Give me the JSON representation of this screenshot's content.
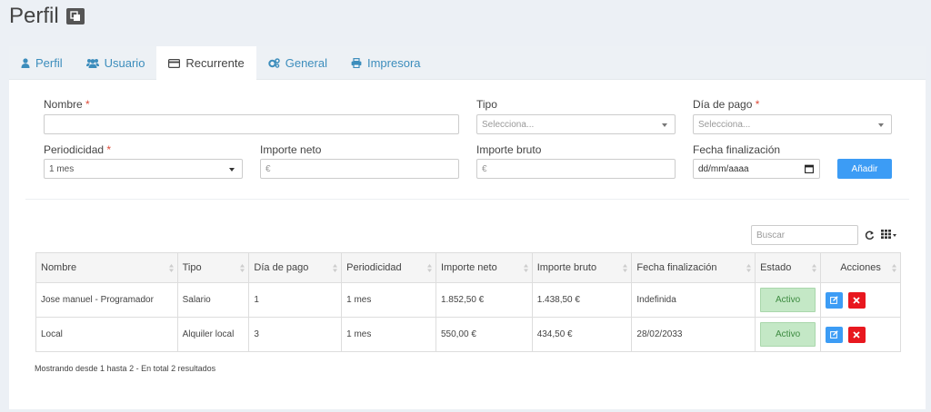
{
  "page": {
    "title": "Perfil"
  },
  "tabs": [
    {
      "label": "Perfil",
      "icon": "user-icon"
    },
    {
      "label": "Usuario",
      "icon": "users-icon"
    },
    {
      "label": "Recurrente",
      "icon": "credit-card-icon",
      "active": true
    },
    {
      "label": "General",
      "icon": "gears-icon"
    },
    {
      "label": "Impresora",
      "icon": "printer-icon"
    }
  ],
  "form": {
    "nombre_label": "Nombre",
    "nombre_value": "",
    "tipo_label": "Tipo",
    "tipo_placeholder": "Selecciona...",
    "dia_label": "Día de pago",
    "dia_placeholder": "Selecciona...",
    "periodicidad_label": "Periodicidad",
    "periodicidad_value": "1 mes",
    "importe_neto_label": "Importe neto",
    "importe_neto_placeholder": "€",
    "importe_bruto_label": "Importe bruto",
    "importe_bruto_placeholder": "€",
    "fecha_label": "Fecha finalización",
    "fecha_placeholder": "dd/mm/aaaa",
    "required_mark": "*",
    "add_button": "Añadir"
  },
  "table": {
    "search_placeholder": "Buscar",
    "headers": [
      "Nombre",
      "Tipo",
      "Día de pago",
      "Periodicidad",
      "Importe neto",
      "Importe bruto",
      "Fecha finalización",
      "Estado",
      "Acciones"
    ],
    "rows": [
      {
        "nombre": "Jose manuel - Programador",
        "tipo": "Salario",
        "dia": "1",
        "periodicidad": "1 mes",
        "importe_neto": "1.852,50 €",
        "importe_bruto": "1.438,50 €",
        "fecha": "Indefinida",
        "estado": "Activo"
      },
      {
        "nombre": "Local",
        "tipo": "Alquiler local",
        "dia": "3",
        "periodicidad": "1 mes",
        "importe_neto": "550,00 €",
        "importe_bruto": "434,50 €",
        "fecha": "28/02/2033",
        "estado": "Activo"
      }
    ],
    "footer": "Mostrando desde 1 hasta 2 - En total 2 resultados"
  },
  "colors": {
    "accent": "#3c9cf5",
    "link": "#3c8dbc",
    "danger": "#e8181f",
    "success_bg": "#c4e8c6",
    "success_text": "#3d8b40"
  }
}
